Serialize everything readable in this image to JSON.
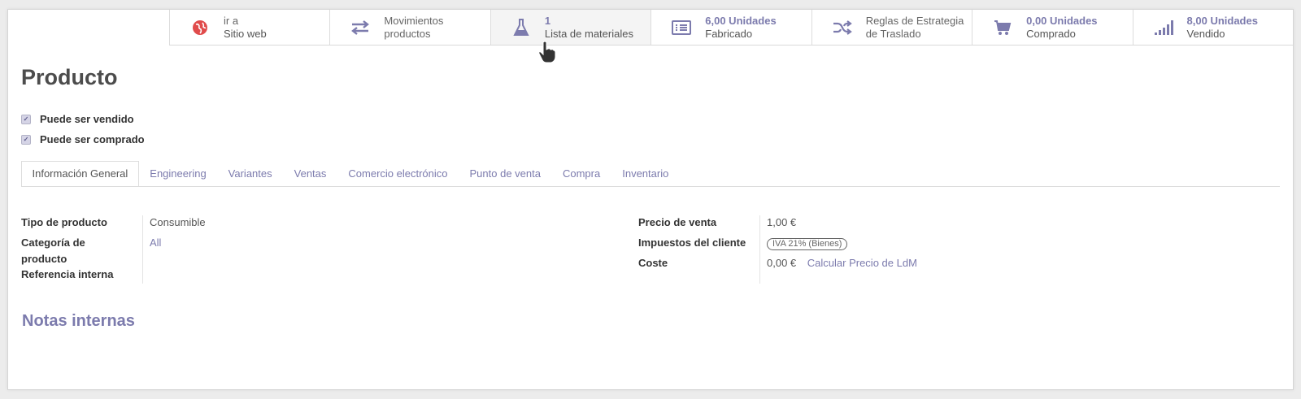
{
  "stat_buttons": [
    {
      "key": "website",
      "line1": "ir a",
      "line2": "Sitio web",
      "icon": "globe-icon"
    },
    {
      "key": "moves",
      "line1": "Movimientos",
      "line2": "productos",
      "icon": "exchange-icon"
    },
    {
      "key": "bom",
      "value": "1",
      "label": "Lista de materiales",
      "icon": "flask-icon"
    },
    {
      "key": "manufactured",
      "value": "6,00 Unidades",
      "label": "Fabricado",
      "icon": "list-icon"
    },
    {
      "key": "routes",
      "line1": "Reglas de Estrategia",
      "line2": "de Traslado",
      "icon": "random-icon"
    },
    {
      "key": "purchased",
      "value": "0,00 Unidades",
      "label": "Comprado",
      "icon": "cart-icon"
    },
    {
      "key": "sold",
      "value": "8,00 Unidades",
      "label": "Vendido",
      "icon": "signal-icon"
    }
  ],
  "product": {
    "name": "Producto"
  },
  "checkboxes": {
    "sale_ok": "Puede ser vendido",
    "purchase_ok": "Puede ser comprado"
  },
  "tabs": [
    "Información General",
    "Engineering",
    "Variantes",
    "Ventas",
    "Comercio electrónico",
    "Punto de venta",
    "Compra",
    "Inventario"
  ],
  "general": {
    "type_label": "Tipo de producto",
    "type_value": "Consumible",
    "categ_label_1": "Categoría de",
    "categ_label_2": "producto",
    "categ_value": "All",
    "ref_label": "Referencia interna",
    "price_label": "Precio de venta",
    "price_value": "1,00 €",
    "taxes_label": "Impuestos del cliente",
    "tax_tag": "IVA 21% (Bienes)",
    "cost_label": "Coste",
    "cost_value": "0,00 €",
    "compute_link": "Calcular Precio de LdM"
  },
  "notes_title": "Notas internas",
  "colors": {
    "accent": "#7c7bad",
    "globe": "#e04b4b"
  }
}
